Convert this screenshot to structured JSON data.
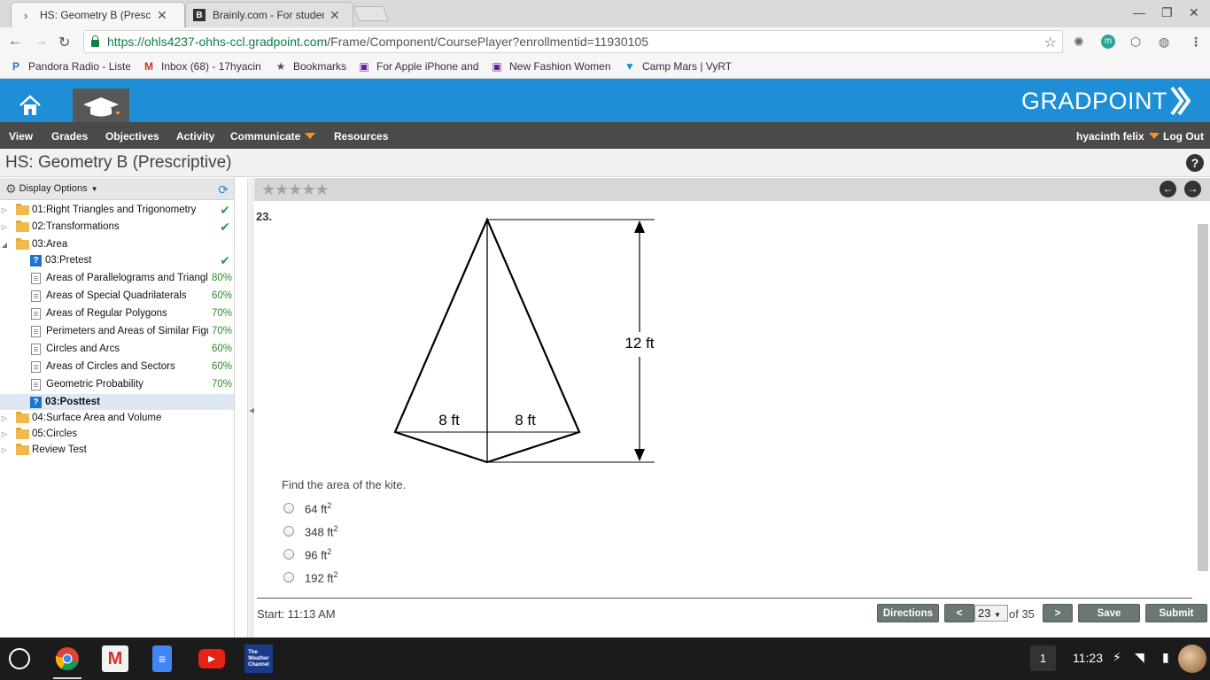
{
  "browser": {
    "tabs": [
      {
        "title": "HS: Geometry B (Prescrip",
        "active": true
      },
      {
        "title": "Brainly.com - For studen",
        "active": false
      }
    ],
    "url_host": "https://ohls4237-ohhs-ccl.gradpoint.com",
    "url_path": "/Frame/Component/CoursePlayer?enrollmentid=11930105",
    "bookmarks": [
      "Pandora Radio - Liste",
      "Inbox (68) - 17hyacin",
      "Bookmarks",
      "For Apple iPhone and",
      "New Fashion Women",
      "Camp Mars | VyRT"
    ]
  },
  "app": {
    "logo": "GRADPOINT",
    "menu": [
      "View",
      "Grades",
      "Objectives",
      "Activity",
      "Communicate",
      "Resources"
    ],
    "user": "hyacinth felix",
    "logout": "Log Out",
    "course_title": "HS: Geometry B (Prescriptive)",
    "help": "?"
  },
  "sidebar": {
    "display_options": "Display Options",
    "items": [
      {
        "label": "01:Right Triangles and Trigonometry",
        "score": "✔"
      },
      {
        "label": "02:Transformations",
        "score": "✔"
      },
      {
        "label": "03:Area",
        "score": ""
      },
      {
        "label": "03:Pretest",
        "score": "✔"
      },
      {
        "label": "Areas of Parallelograms and Triangles",
        "score": "80%"
      },
      {
        "label": "Areas of Special Quadrilaterals",
        "score": "60%"
      },
      {
        "label": "Areas of Regular Polygons",
        "score": "70%"
      },
      {
        "label": "Perimeters and Areas of Similar Figures",
        "score": "70%"
      },
      {
        "label": "Circles and Arcs",
        "score": "60%"
      },
      {
        "label": "Areas of Circles and Sectors",
        "score": "60%"
      },
      {
        "label": "Geometric Probability",
        "score": "70%"
      },
      {
        "label": "03:Posttest",
        "score": ""
      },
      {
        "label": "04:Surface Area and Volume",
        "score": ""
      },
      {
        "label": "05:Circles",
        "score": ""
      },
      {
        "label": "Review Test",
        "score": ""
      }
    ]
  },
  "question": {
    "number": "23.",
    "figure": {
      "height_label": "12 ft",
      "left_label": "8 ft",
      "right_label": "8 ft"
    },
    "prompt": "Find the area of the kite.",
    "options": [
      {
        "value": "64 ft",
        "exp": "2"
      },
      {
        "value": "348 ft",
        "exp": "2"
      },
      {
        "value": "96 ft",
        "exp": "2"
      },
      {
        "value": "192 ft",
        "exp": "2"
      }
    ]
  },
  "footer": {
    "start": "Start: 11:13 AM",
    "directions": "Directions",
    "prev": "<",
    "page": "23",
    "of": "of 35",
    "next": ">",
    "save": "Save",
    "submit": "Submit"
  },
  "taskbar": {
    "notification_count": "1",
    "time": "11:23"
  }
}
